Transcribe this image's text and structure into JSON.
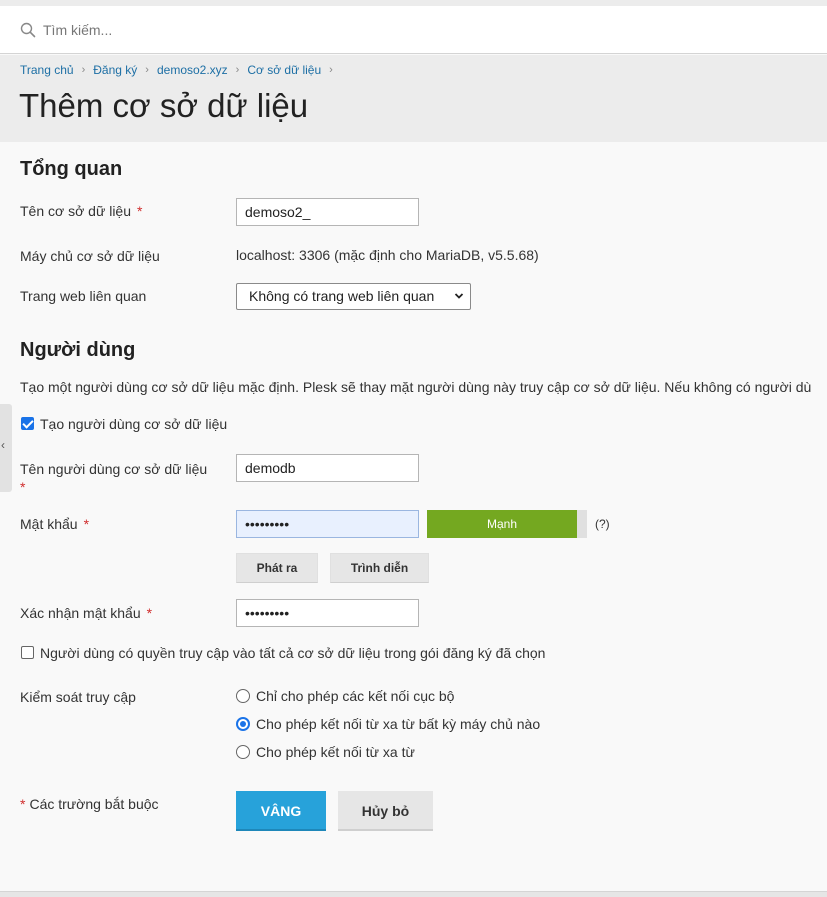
{
  "search": {
    "placeholder": "Tìm kiếm..."
  },
  "breadcrumb": [
    "Trang chủ",
    "Đăng ký",
    "demoso2.xyz",
    "Cơ sở dữ liệu"
  ],
  "page_title": "Thêm cơ sở dữ liệu",
  "overview": {
    "title": "Tổng quan",
    "db_name_label": "Tên cơ sở dữ liệu",
    "db_name_value": "demoso2_",
    "db_server_label": "Máy chủ cơ sở dữ liệu",
    "db_server_value": "localhost: 3306 (mặc định cho MariaDB, v5.5.68)",
    "related_site_label": "Trang web liên quan",
    "related_site_value": "Không có trang web liên quan"
  },
  "user": {
    "title": "Người dùng",
    "description": "Tạo một người dùng cơ sở dữ liệu mặc định. Plesk sẽ thay mặt người dùng này truy cập cơ sở dữ liệu. Nếu không có người dù",
    "create_user_label": "Tạo người dùng cơ sở dữ liệu",
    "create_user_checked": true,
    "username_label": "Tên người dùng cơ sở dữ liệu",
    "username_value": "demodb",
    "password_label": "Mật khẩu",
    "password_value": "•••••••••",
    "strength_label": "Mạnh",
    "strength_level": 0.94,
    "help_mark": "(?)",
    "generate_label": "Phát ra",
    "show_label": "Trình diễn",
    "confirm_label": "Xác nhận mật khẩu",
    "confirm_value": "•••••••••",
    "all_db_access_label": "Người dùng có quyền truy cập vào tất cả cơ sở dữ liệu trong gói đăng ký đã chọn",
    "all_db_access_checked": false,
    "access_control_label": "Kiểm soát truy cập",
    "access_options": [
      {
        "label": "Chỉ cho phép các kết nối cục bộ",
        "checked": false
      },
      {
        "label": "Cho phép kết nối từ xa từ bất kỳ máy chủ nào",
        "checked": true
      },
      {
        "label": "Cho phép kết nối từ xa từ",
        "checked": false
      }
    ]
  },
  "footer": {
    "required_note": "Các trường bắt buộc",
    "required_mark": "*",
    "ok_label": "VÂNG",
    "cancel_label": "Hủy bỏ"
  },
  "colors": {
    "accent": "#27a2da",
    "strength": "#74a820",
    "link": "#1d6fa5",
    "required": "#d02e2e"
  }
}
